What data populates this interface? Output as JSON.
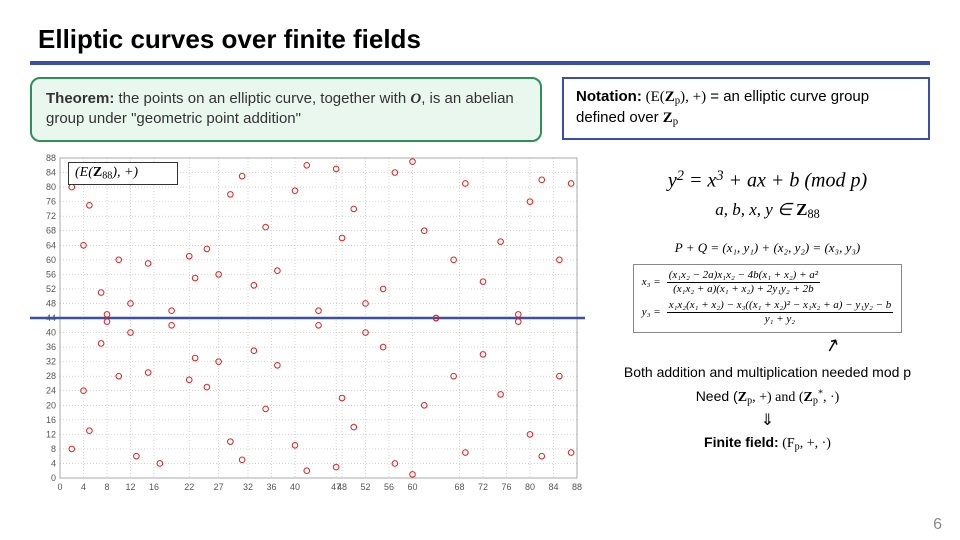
{
  "title": "Elliptic curves over finite fields",
  "theorem": {
    "label": "Theorem:",
    "body_1": "the points on an elliptic curve, together with ",
    "O": "O",
    "body_2": ", is an abelian group under \"geometric point addition\""
  },
  "notation": {
    "label": "Notation:",
    "lhs_open": "(E(",
    "Z": "Z",
    "p": "p",
    "lhs_close": "), +)",
    "eq": " = an elliptic curve group defined over ",
    "Z2": "Z",
    "p2": "p"
  },
  "chart_label": {
    "open": "(E(",
    "Z": "Z",
    "sub": "88",
    "close": "), +)"
  },
  "equations": {
    "main_lhs": "y",
    "main_sq": "2",
    "main_eq": " = x",
    "main_cube": "3",
    "main_rest": " + ax + b (mod p)",
    "set_vars": "a, b, x, y ∈ ",
    "set_Z": "Z",
    "set_sub": "88",
    "pq": "P + Q = (x₁, y₁) + (x₂, y₂) = (x₃, y₃)",
    "x3_lhs": "x₃ =",
    "x3_num": "(x₁x₂ − 2a)x₁x₂ − 4b(x₁ + x₂) + a²",
    "x3_den": "(x₁x₂ + a)(x₁ + x₂) + 2y₁y₂ + 2b",
    "y3_lhs": "y₃ =",
    "y3_num": "x₁x₂(x₁ + x₂) − x₃((x₁ + x₂)² − x₁x₂ + a) − y₁y₂ − b",
    "y3_den": "y₁ + y₂"
  },
  "notes": {
    "both": "Both addition and multiplication needed mod p",
    "need_pre": "Need (",
    "Zp1": "Z",
    "p1": "p",
    "need_mid": ", +) and (",
    "Zp2": "Z",
    "p2": "p",
    "star": "*",
    "need_end": ", ·)",
    "darrow": "⇓",
    "ff_label": "Finite field:",
    "ff_open": " (F",
    "ff_p": "p",
    "ff_close": ", +, ·)"
  },
  "page": "6",
  "chart_data": {
    "type": "scatter",
    "xlabel": "",
    "ylabel": "",
    "xlim": [
      0,
      88
    ],
    "ylim": [
      0,
      88
    ],
    "xticks": [
      0,
      4,
      8,
      12,
      16,
      22,
      27,
      32,
      36,
      40,
      47,
      48,
      52,
      56,
      60,
      68,
      72,
      76,
      80,
      84,
      88
    ],
    "yticks": [
      0,
      4,
      8,
      12,
      16,
      20,
      24,
      28,
      32,
      36,
      40,
      44,
      48,
      52,
      56,
      60,
      64,
      68,
      72,
      76,
      80,
      84,
      88
    ],
    "midline_y": 44,
    "series": [
      {
        "name": "points",
        "values": [
          [
            2,
            8
          ],
          [
            2,
            80
          ],
          [
            4,
            24
          ],
          [
            4,
            64
          ],
          [
            5,
            75
          ],
          [
            5,
            13
          ],
          [
            7,
            37
          ],
          [
            7,
            51
          ],
          [
            8,
            43
          ],
          [
            8,
            45
          ],
          [
            10,
            60
          ],
          [
            10,
            28
          ],
          [
            12,
            48
          ],
          [
            12,
            40
          ],
          [
            13,
            6
          ],
          [
            13,
            82
          ],
          [
            15,
            29
          ],
          [
            15,
            59
          ],
          [
            17,
            84
          ],
          [
            17,
            4
          ],
          [
            19,
            42
          ],
          [
            19,
            46
          ],
          [
            22,
            61
          ],
          [
            22,
            27
          ],
          [
            23,
            55
          ],
          [
            23,
            33
          ],
          [
            25,
            63
          ],
          [
            25,
            25
          ],
          [
            27,
            32
          ],
          [
            27,
            56
          ],
          [
            29,
            78
          ],
          [
            29,
            10
          ],
          [
            31,
            5
          ],
          [
            31,
            83
          ],
          [
            33,
            35
          ],
          [
            33,
            53
          ],
          [
            35,
            69
          ],
          [
            35,
            19
          ],
          [
            37,
            31
          ],
          [
            37,
            57
          ],
          [
            40,
            79
          ],
          [
            40,
            9
          ],
          [
            42,
            2
          ],
          [
            42,
            86
          ],
          [
            44,
            46
          ],
          [
            44,
            42
          ],
          [
            47,
            3
          ],
          [
            47,
            85
          ],
          [
            48,
            22
          ],
          [
            48,
            66
          ],
          [
            50,
            14
          ],
          [
            50,
            74
          ],
          [
            52,
            48
          ],
          [
            52,
            40
          ],
          [
            55,
            36
          ],
          [
            55,
            52
          ],
          [
            57,
            4
          ],
          [
            57,
            84
          ],
          [
            60,
            87
          ],
          [
            60,
            1
          ],
          [
            62,
            20
          ],
          [
            62,
            68
          ],
          [
            64,
            44
          ],
          [
            64,
            44
          ],
          [
            67,
            28
          ],
          [
            67,
            60
          ],
          [
            69,
            7
          ],
          [
            69,
            81
          ],
          [
            72,
            54
          ],
          [
            72,
            34
          ],
          [
            75,
            65
          ],
          [
            75,
            23
          ],
          [
            78,
            43
          ],
          [
            78,
            45
          ],
          [
            80,
            12
          ],
          [
            80,
            76
          ],
          [
            82,
            6
          ],
          [
            82,
            82
          ],
          [
            85,
            28
          ],
          [
            85,
            60
          ],
          [
            87,
            7
          ],
          [
            87,
            81
          ]
        ]
      }
    ]
  }
}
